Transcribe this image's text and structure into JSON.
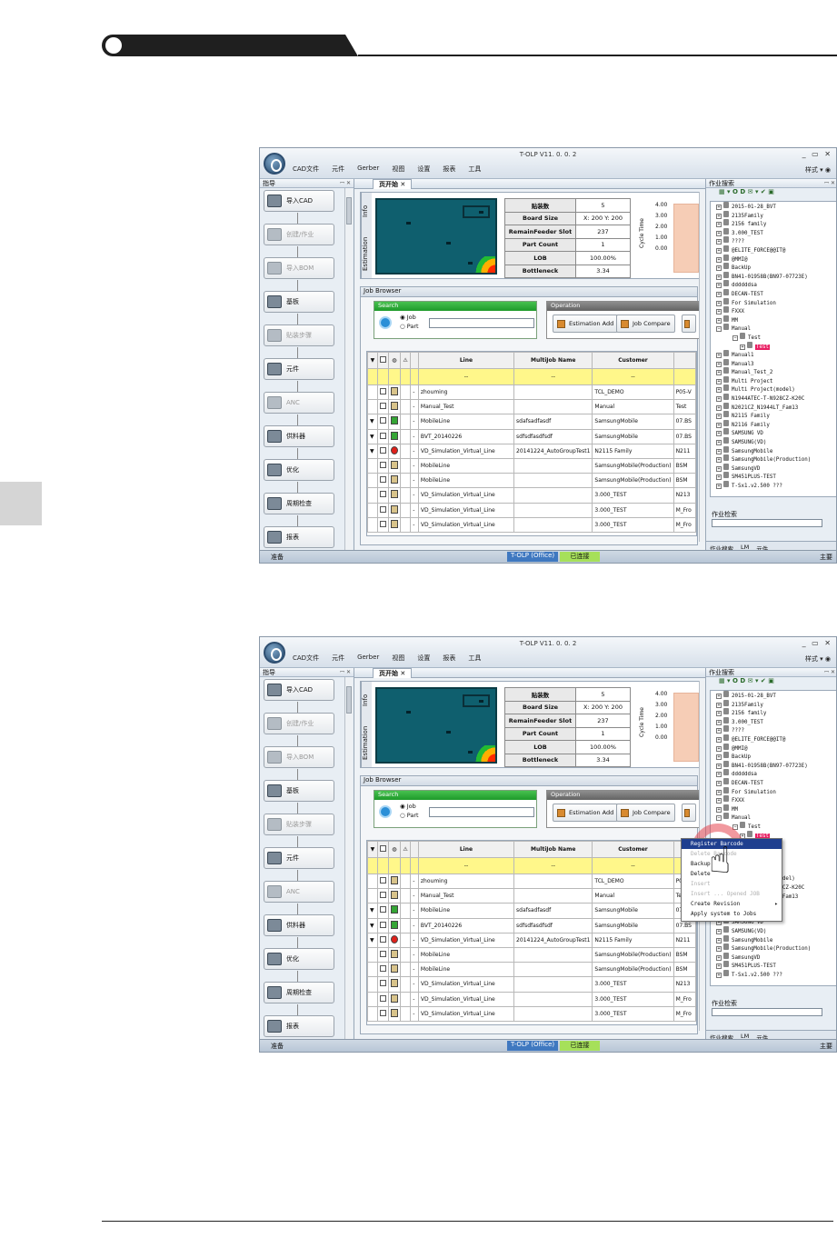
{
  "manual": {
    "header_visible": true
  },
  "app": {
    "title": "T-OLP V11. 0. 0. 2",
    "window_controls": "_ ▭ ✕",
    "menu": [
      "CAD文件",
      "元件",
      "Gerber",
      "视图",
      "设置",
      "报表",
      "工具"
    ],
    "style_menu": "样式 ▾ ◉"
  },
  "guide_panel": {
    "title": "指导",
    "controls": "ꟷ ✕",
    "items": [
      {
        "label": "导入CAD",
        "enabled": true
      },
      {
        "label": "创建/作业",
        "enabled": false
      },
      {
        "label": "导入BOM",
        "enabled": false
      },
      {
        "label": "基板",
        "enabled": true
      },
      {
        "label": "贴装步骤",
        "enabled": false
      },
      {
        "label": "元件",
        "enabled": true
      },
      {
        "label": "ANC",
        "enabled": false
      },
      {
        "label": "供料器",
        "enabled": true
      },
      {
        "label": "优化",
        "enabled": true
      },
      {
        "label": "周期检查",
        "enabled": true
      },
      {
        "label": "报表",
        "enabled": true
      }
    ]
  },
  "document": {
    "tab": "页开始 ✕",
    "vtabs": [
      "Info",
      "Estimation"
    ],
    "stats": [
      {
        "k": "贴装数",
        "v": "5"
      },
      {
        "k": "Board Size",
        "v": "X: 200  Y: 200"
      },
      {
        "k": "RemainFeeder Slot",
        "v": "237"
      },
      {
        "k": "Part Count",
        "v": "1"
      },
      {
        "k": "LOB",
        "v": "100.00%"
      },
      {
        "k": "Bottleneck",
        "v": "3.34"
      }
    ],
    "cycle_time": {
      "label": "Cycle Time",
      "ticks": [
        "4.00",
        "3.00",
        "2.00",
        "1.00",
        "0.00"
      ]
    }
  },
  "job_browser": {
    "title": "Job Browser",
    "search": {
      "header": "Search",
      "radio_job": "Job",
      "radio_part": "Part"
    },
    "operation": {
      "header": "Operation",
      "estimation_add": "Estimation Add",
      "job_compare": "Job Compare"
    },
    "columns": [
      "Line",
      "MultiJob Name",
      "Customer"
    ],
    "filter_value": "--",
    "rows": [
      {
        "arrow": "",
        "icon": "doc",
        "line": "zhouming",
        "multijob": "",
        "customer": "TCL_DEMO",
        "extra": "P05-V"
      },
      {
        "arrow": "",
        "icon": "doc",
        "line": "Manual_Test",
        "multijob": "",
        "customer": "Manual",
        "extra": "Test"
      },
      {
        "arrow": "▼",
        "icon": "green",
        "line": "MobileLine",
        "multijob": "sdafsadfasdf",
        "customer": "SamsungMobile",
        "extra": "07.BS"
      },
      {
        "arrow": "▼",
        "icon": "green",
        "line": "BVT_20140226",
        "multijob": "sdfsdfasdfsdf",
        "customer": "SamsungMobile",
        "extra": "07.BS"
      },
      {
        "arrow": "▼",
        "icon": "red",
        "line": "VD_Simulation_Virtual_Line",
        "multijob": "20141224_AutoGroupTest1",
        "customer": "N2115 Family",
        "extra": "N211"
      },
      {
        "arrow": "",
        "icon": "doc",
        "line": "MobileLine",
        "multijob": "",
        "customer": "SamsungMobile(Production)",
        "extra": "BSM"
      },
      {
        "arrow": "",
        "icon": "doc",
        "line": "MobileLine",
        "multijob": "",
        "customer": "SamsungMobile(Production)",
        "extra": "BSM"
      },
      {
        "arrow": "",
        "icon": "doc",
        "line": "VD_Simulation_Virtual_Line",
        "multijob": "",
        "customer": "3.000_TEST",
        "extra": "N213"
      },
      {
        "arrow": "",
        "icon": "doc",
        "line": "VD_Simulation_Virtual_Line",
        "multijob": "",
        "customer": "3.000_TEST",
        "extra": "M_Fro"
      },
      {
        "arrow": "",
        "icon": "doc",
        "line": "VD_Simulation_Virtual_Line",
        "multijob": "",
        "customer": "3.000_TEST",
        "extra": "M_Fro"
      }
    ]
  },
  "job_search_panel": {
    "title": "作业搜索",
    "controls": "ꟷ ✕",
    "toolbar": "▦ ▾  O  D  ✉ ▾  ✔  ▣",
    "tree": [
      "2015-01-28_BVT",
      "2135Family",
      "2156 family",
      "3.000_TEST",
      "????",
      "@ELITE_FORCE@@IT@",
      "@MMI@",
      "BackUp",
      "BN41-01958B(BN97-07723E)",
      "ddddddsa",
      "DECAN-TEST",
      "For Simulation",
      "FXXX",
      "MM",
      "Manual",
      "Test",
      "Test",
      "Manual1",
      "Manual3",
      "Manual_Test_2",
      "Multi Project",
      "Multi Project(model)",
      "N1944ATEC-T-N928CZ-K20C",
      "N2021CZ_N1944LT_Fam13",
      "N2115 Family",
      "N2116 Family",
      "SAMSUNG VD",
      "SAMSUNG(VD)",
      "SamsungMobile",
      "SamsungMobile(Production)",
      "SamsungVD",
      "SM451PLUS-TEST",
      "T-Sx1.v2.500 ???"
    ],
    "search_label": "作业检索",
    "tabs": [
      "作业搜索",
      "LM",
      "元件"
    ]
  },
  "status": {
    "ready": "准备",
    "office": "T-OLP (Office)",
    "connected": "已连接",
    "main": "主要"
  },
  "context_menu": {
    "items": [
      {
        "label": "Register Barcode",
        "state": "highlight"
      },
      {
        "label": "Delete Barcode",
        "state": "disabled"
      },
      {
        "label": "Backup",
        "state": "normal"
      },
      {
        "label": "Delete",
        "state": "normal"
      },
      {
        "label": "Insert",
        "state": "disabled"
      },
      {
        "label": "Insert ... Opened JOB",
        "state": "disabled"
      },
      {
        "label": "Create Revision",
        "state": "normal",
        "submenu": "▸"
      },
      {
        "label": "Apply system to Jobs",
        "state": "normal"
      }
    ]
  },
  "colors": {
    "header_dark": "#1f1f1f",
    "search_green": "#1e9a2a",
    "filter_yellow": "#fff78a",
    "tree_selected": "#e91f63",
    "menu_highlight": "#1f3f8f"
  }
}
